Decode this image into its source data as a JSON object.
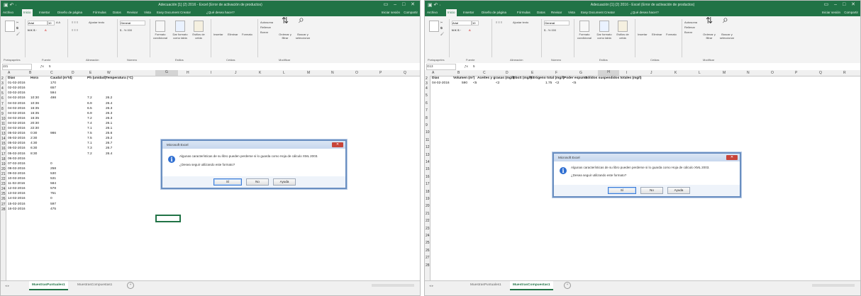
{
  "left": {
    "title": "Adecuación [1] (2) 2016 - Excel (Error de activación de productos)",
    "tabs": [
      "Archivo",
      "Inicio",
      "Insertar",
      "Diseño de página",
      "Fórmulas",
      "Datos",
      "Revisar",
      "Vista",
      "Easy Document Creator",
      "¿Qué desea hacer?"
    ],
    "signin": "Iniciar sesión",
    "share": "Compartir",
    "ribbon": {
      "font_name": "Arial",
      "font_size": "10",
      "wrap_text": "Ajustar texto",
      "number_format": "General",
      "conditional_format": "Formato condicional",
      "as_table": "Dar formato como tabla",
      "cell_styles": "Estilos de celda",
      "insert": "Insertar",
      "delete": "Eliminar",
      "format": "Formato",
      "autosum": "Autosuma",
      "fill": "Rellenar",
      "clear": "Borrar",
      "sort_filter": "Ordenar y filtrar",
      "find_select": "Buscar y seleccionar",
      "groups": [
        "Portapapeles",
        "Fuente",
        "Alineación",
        "Número",
        "Estilos",
        "Celdas",
        "Modificar"
      ]
    },
    "namebox": "J21",
    "formula": "5",
    "columns": [
      "A",
      "B",
      "C",
      "D",
      "E",
      "W",
      "G",
      "H",
      "I",
      "J",
      "K",
      "L",
      "M",
      "N",
      "O",
      "P",
      "Q",
      "R",
      "S",
      "T"
    ],
    "rows": [
      {
        "n": "2",
        "date": "Dias",
        "hora": "Hora",
        "caudal": "Caudal (m³/d)",
        "ph": "Ph (unidad)",
        "temp": "Temperatura (°C)"
      },
      {
        "n": "3",
        "date": "01-02-2016",
        "hora": "",
        "caudal": "170",
        "ph": "",
        "temp": ""
      },
      {
        "n": "4",
        "date": "02-02-2016",
        "hora": "",
        "caudal": "657",
        "ph": "",
        "temp": ""
      },
      {
        "n": "5",
        "date": "03-02-2016",
        "hora": "",
        "caudal": "594",
        "ph": "",
        "temp": ""
      },
      {
        "n": "6",
        "date": "04-02-2016",
        "hora": "10:30",
        "caudal": "498",
        "ph": "7.2",
        "temp": "26.2"
      },
      {
        "n": "7",
        "date": "04-02-2016",
        "hora": "10:36",
        "caudal": "",
        "ph": "6.9",
        "temp": "26.4"
      },
      {
        "n": "8",
        "date": "04-02-2016",
        "hora": "16:35",
        "caudal": "",
        "ph": "6.5",
        "temp": "26.3"
      },
      {
        "n": "9",
        "date": "04-02-2016",
        "hora": "16:35",
        "caudal": "",
        "ph": "6.9",
        "temp": "26.3"
      },
      {
        "n": "10",
        "date": "04-02-2016",
        "hora": "16:35",
        "caudal": "",
        "ph": "7.2",
        "temp": "26.3"
      },
      {
        "n": "11",
        "date": "04-02-2016",
        "hora": "20:30",
        "caudal": "",
        "ph": "7.4",
        "temp": "26.1"
      },
      {
        "n": "12",
        "date": "04-02-2016",
        "hora": "22:30",
        "caudal": "",
        "ph": "7.1",
        "temp": "26.1"
      },
      {
        "n": "13",
        "date": "05-02-2016",
        "hora": "0:30",
        "caudal": "986",
        "ph": "7.5",
        "temp": "25.6"
      },
      {
        "n": "14",
        "date": "05-02-2016",
        "hora": "2:30",
        "caudal": "",
        "ph": "7.5",
        "temp": "25.2"
      },
      {
        "n": "15",
        "date": "05-02-2016",
        "hora": "4:30",
        "caudal": "",
        "ph": "7.1",
        "temp": "26.7"
      },
      {
        "n": "16",
        "date": "05-02-2016",
        "hora": "6:30",
        "caudal": "",
        "ph": "7.3",
        "temp": "26.7"
      },
      {
        "n": "17",
        "date": "05-02-2016",
        "hora": "8:30",
        "caudal": "",
        "ph": "7.2",
        "temp": "26.4"
      },
      {
        "n": "18",
        "date": "06-02-2016",
        "hora": "",
        "caudal": "",
        "ph": "",
        "temp": ""
      },
      {
        "n": "19",
        "date": "07-02-2016",
        "hora": "",
        "caudal": "0",
        "ph": "",
        "temp": ""
      },
      {
        "n": "20",
        "date": "08-02-2016",
        "hora": "",
        "caudal": "258",
        "ph": "",
        "temp": ""
      },
      {
        "n": "21",
        "date": "09-02-2016",
        "hora": "",
        "caudal": "530",
        "ph": "",
        "temp": ""
      },
      {
        "n": "22",
        "date": "10-02-2016",
        "hora": "",
        "caudal": "531",
        "ph": "",
        "temp": ""
      },
      {
        "n": "23",
        "date": "11-02-2016",
        "hora": "",
        "caudal": "584",
        "ph": "",
        "temp": ""
      },
      {
        "n": "24",
        "date": "12-02-2016",
        "hora": "",
        "caudal": "578",
        "ph": "",
        "temp": ""
      },
      {
        "n": "25",
        "date": "13-02-2016",
        "hora": "",
        "caudal": "751",
        "ph": "",
        "temp": ""
      },
      {
        "n": "26",
        "date": "14-02-2016",
        "hora": "",
        "caudal": "0",
        "ph": "",
        "temp": ""
      },
      {
        "n": "27",
        "date": "15-02-2016",
        "hora": "",
        "caudal": "597",
        "ph": "",
        "temp": ""
      },
      {
        "n": "28",
        "date": "16-02-2016",
        "hora": "",
        "caudal": "475",
        "ph": "",
        "temp": ""
      }
    ],
    "sheets": [
      "MuestrasPuntuales1",
      "MuestrasCompuestas1"
    ],
    "active_sheet": 0
  },
  "right": {
    "title": "Adecuación [1] (2) 2016 - Excel (Error de activación de productos)",
    "tabs": [
      "Archivo",
      "Inicio",
      "Insertar",
      "Diseño de página",
      "Fórmulas",
      "Datos",
      "Revisar",
      "Vista",
      "Easy Document Creator",
      "¿Qué desea hacer?"
    ],
    "signin": "Iniciar sesión",
    "share": "Compartir",
    "namebox": "G13",
    "formula": "5",
    "columns": [
      "A",
      "B",
      "C",
      "D",
      "E",
      "F",
      "G",
      "H",
      "I",
      "J",
      "K",
      "L",
      "M",
      "N",
      "O",
      "P",
      "Q",
      "R",
      "S",
      "T"
    ],
    "header_row": {
      "n": "2",
      "a": "Dias",
      "b": "Volumen (m³)",
      "c": "Aceites y grasas (mg/l)",
      "d": "DboS (mg/l)",
      "e": "Nitrógeno total (mg/l)",
      "f": "Poder espuma",
      "g": "Sólidos suspendidos totales (mg/l)"
    },
    "data_row": {
      "n": "3",
      "a": "04-02-2016",
      "b": "590",
      "c": "<5",
      "d": "<2",
      "e": "1.75",
      "f": "<2",
      "g": "<5"
    },
    "row_numbers": [
      "4",
      "5",
      "6",
      "7",
      "8",
      "9",
      "10",
      "11",
      "12",
      "13",
      "14",
      "15",
      "16",
      "17",
      "18",
      "19",
      "20",
      "21",
      "22",
      "23",
      "24",
      "25",
      "26",
      "27",
      "28"
    ],
    "sheets": [
      "MuestrasPuntuales1",
      "MuestrasCompuestas1"
    ],
    "active_sheet": 1
  },
  "dialog": {
    "title": "Microsoft Excel",
    "message": "Algunas características de su libro pueden perderse si lo guarda como Hoja de cálculo XML 2003.",
    "question": "¿Desea seguir utilizando este formato?",
    "yes": "Sí",
    "no": "No",
    "help": "Ayuda"
  },
  "colors": {
    "excel_green": "#217346",
    "dialog_border": "#6a8fc1",
    "close_red": "#c8453a",
    "info_blue": "#2f6fd2"
  }
}
